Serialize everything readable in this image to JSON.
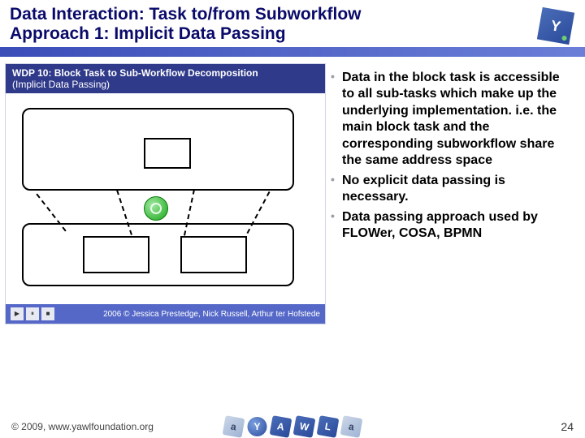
{
  "header": {
    "title_line1": "Data Interaction: Task to/from Subworkflow",
    "title_line2": "Approach 1: Implicit Data Passing",
    "logo_letter": "Y"
  },
  "figure": {
    "title_bold": "WDP 10: Block Task to Sub-Workflow Decomposition",
    "title_light": "(Implicit Data Passing)",
    "controls": {
      "play": "▶",
      "pause": "⏸",
      "stop": "■"
    },
    "credit": "2006 © Jessica Prestedge, Nick Russell, Arthur ter Hofstede"
  },
  "bullets": [
    "Data in the block task is accessible to all sub-tasks which make up the underlying implementation. i.e. the main block task and the corresponding subworkflow share the same address space",
    "No explicit data passing is necessary.",
    "Data passing approach used by FLOWer, COSA, BPMN"
  ],
  "footer": {
    "copyright": "© 2009, www.yawlfoundation.org",
    "page": "24",
    "logo_letters": [
      "a",
      "Y",
      "A",
      "W",
      "L",
      "a"
    ]
  }
}
